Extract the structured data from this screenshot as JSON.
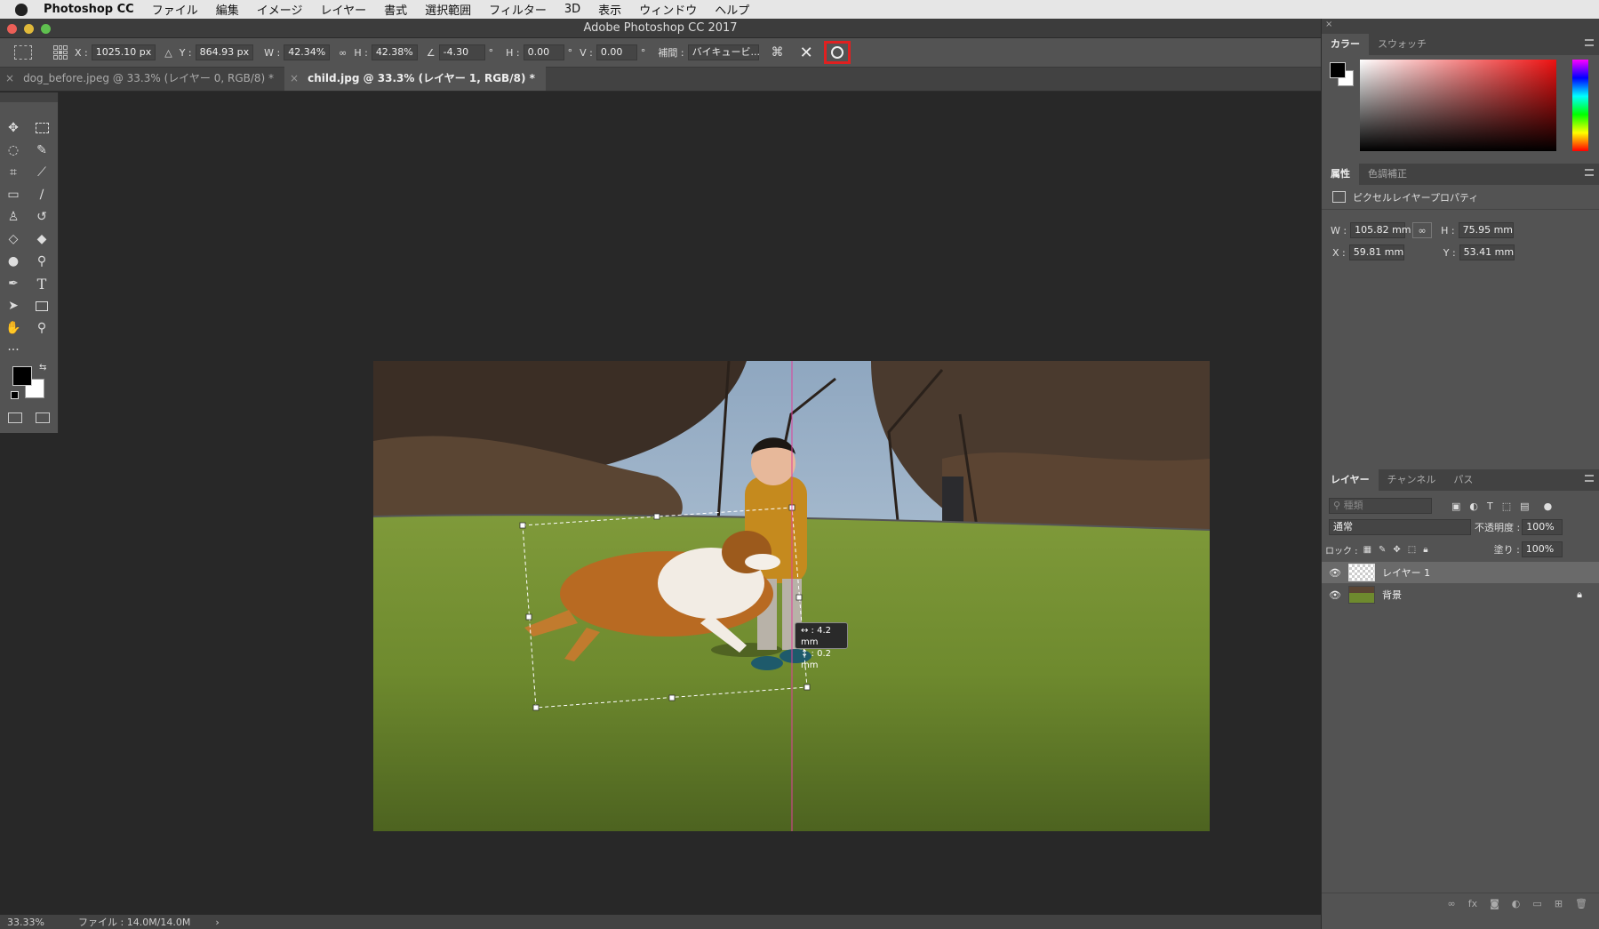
{
  "menubar": {
    "app_name": "Photoshop CC",
    "items": [
      "ファイル",
      "編集",
      "イメージ",
      "レイヤー",
      "書式",
      "選択範囲",
      "フィルター",
      "3D",
      "表示",
      "ウィンドウ",
      "ヘルプ"
    ]
  },
  "window": {
    "title": "Adobe Photoshop CC 2017"
  },
  "options_bar": {
    "x_label": "X :",
    "x_value": "1025.10 px",
    "y_label": "Y :",
    "y_value": "864.93 px",
    "w_label": "W :",
    "w_value": "42.34%",
    "h_label": "H :",
    "h_value": "42.38%",
    "angle_value": "-4.30",
    "deg1": "°",
    "hskew_label": "H :",
    "hskew_value": "0.00",
    "deg2": "°",
    "vskew_label": "V :",
    "vskew_value": "0.00",
    "deg3": "°",
    "interp_label": "補間 :",
    "interp_value": "バイキュービ..."
  },
  "tabs": [
    {
      "label": "dog_before.jpeg @ 33.3% (レイヤー 0, RGB/8) *",
      "active": false
    },
    {
      "label": "child.jpg @ 33.3% (レイヤー 1, RGB/8) *",
      "active": true
    }
  ],
  "canvas": {
    "tooltip_line1": "↔ : 4.2 mm",
    "tooltip_line2": "↕ : 0.2 mm"
  },
  "status": {
    "zoom": "33.33%",
    "file": "ファイル : 14.0M/14.0M",
    "arrow": "›"
  },
  "color_panel": {
    "tabs": [
      "カラー",
      "スウォッチ"
    ]
  },
  "properties_panel": {
    "tabs": [
      "属性",
      "色調補正"
    ],
    "header": "ピクセルレイヤープロパティ",
    "w_label": "W :",
    "w_value": "105.82 mm",
    "h_label": "H :",
    "h_value": "75.95 mm",
    "x_label": "X :",
    "x_value": "59.81 mm",
    "y_label": "Y :",
    "y_value": "53.41 mm"
  },
  "layers_panel": {
    "tabs": [
      "レイヤー",
      "チャンネル",
      "パス"
    ],
    "filter_placeholder": "種類",
    "blend_mode": "通常",
    "opacity_label": "不透明度 :",
    "opacity_value": "100%",
    "lock_label": "ロック :",
    "fill_label": "塗り :",
    "fill_value": "100%",
    "layers": [
      {
        "name": "レイヤー 1",
        "selected": true
      },
      {
        "name": "背景",
        "selected": false
      }
    ]
  },
  "colors": {
    "accent_red": "#e02020",
    "guide_magenta": "#e0409a"
  }
}
